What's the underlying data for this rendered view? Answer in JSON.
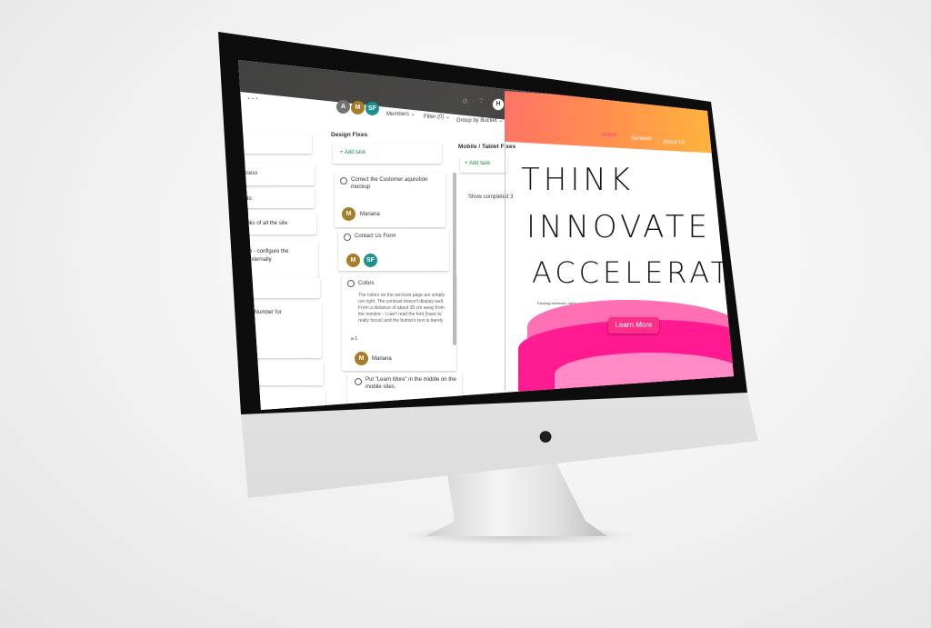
{
  "planner": {
    "menu_dots": "...",
    "avatars": [
      {
        "initials": "A",
        "color": "#6b6b6b"
      },
      {
        "initials": "M",
        "color": "#a2741a"
      },
      {
        "initials": "SF",
        "color": "#0b8a85"
      }
    ],
    "header_icons": {
      "settings": "settings-icon",
      "help": "?",
      "user_initial": "H"
    },
    "members_label": "Members",
    "filter_label": "Filter (0)",
    "group_label": "Group by Bucket",
    "left_partial_items": [
      "ccess",
      "rdo",
      "anks of all the site",
      "site - configure the",
      "g externally",
      "rdo",
      "one Number for",
      "ariana",
      "rdo"
    ],
    "column_design": {
      "title": "Design Fixes",
      "add_task": "Add task",
      "cards": [
        {
          "title": "Correct the Customer aquisition mockup",
          "assignee_initial": "M",
          "assignee_name": "Mariana"
        },
        {
          "title": "Contact Us Form",
          "avatars": [
            "M",
            "SF"
          ]
        },
        {
          "title": "Colors",
          "description": "The colors on the services page are simply not right. The contrast doesn't display well. From a distance of about 30 cm away from the monitor - I can't read the font (have to really focus) and the button's text is barely",
          "attachments": "1",
          "assignee_initial": "M",
          "assignee_name": "Mariana"
        },
        {
          "title": "Put \"Learn More\" in the middle on the mobile sites."
        }
      ]
    },
    "column_mobile": {
      "title": "Mobile / Tablet Fixes",
      "add_task": "Add task",
      "show_completed": "Show completed",
      "completed_count": "3"
    }
  },
  "website": {
    "nav": {
      "home": "Home",
      "services": "Services",
      "about": "About Us"
    },
    "headline": [
      "THINK",
      "INNOVATE",
      "ACCELERATE"
    ],
    "tagline": "Thinking delivered, ideas created, limits reduced, people empowered, growth enabled.",
    "cta": "Learn More",
    "colors": {
      "primary": "#ff2e88",
      "gradient_start": "#ff6c5c",
      "gradient_end": "#ffbf3a"
    }
  },
  "device": {
    "logo_icon": "apple-logo-icon"
  }
}
